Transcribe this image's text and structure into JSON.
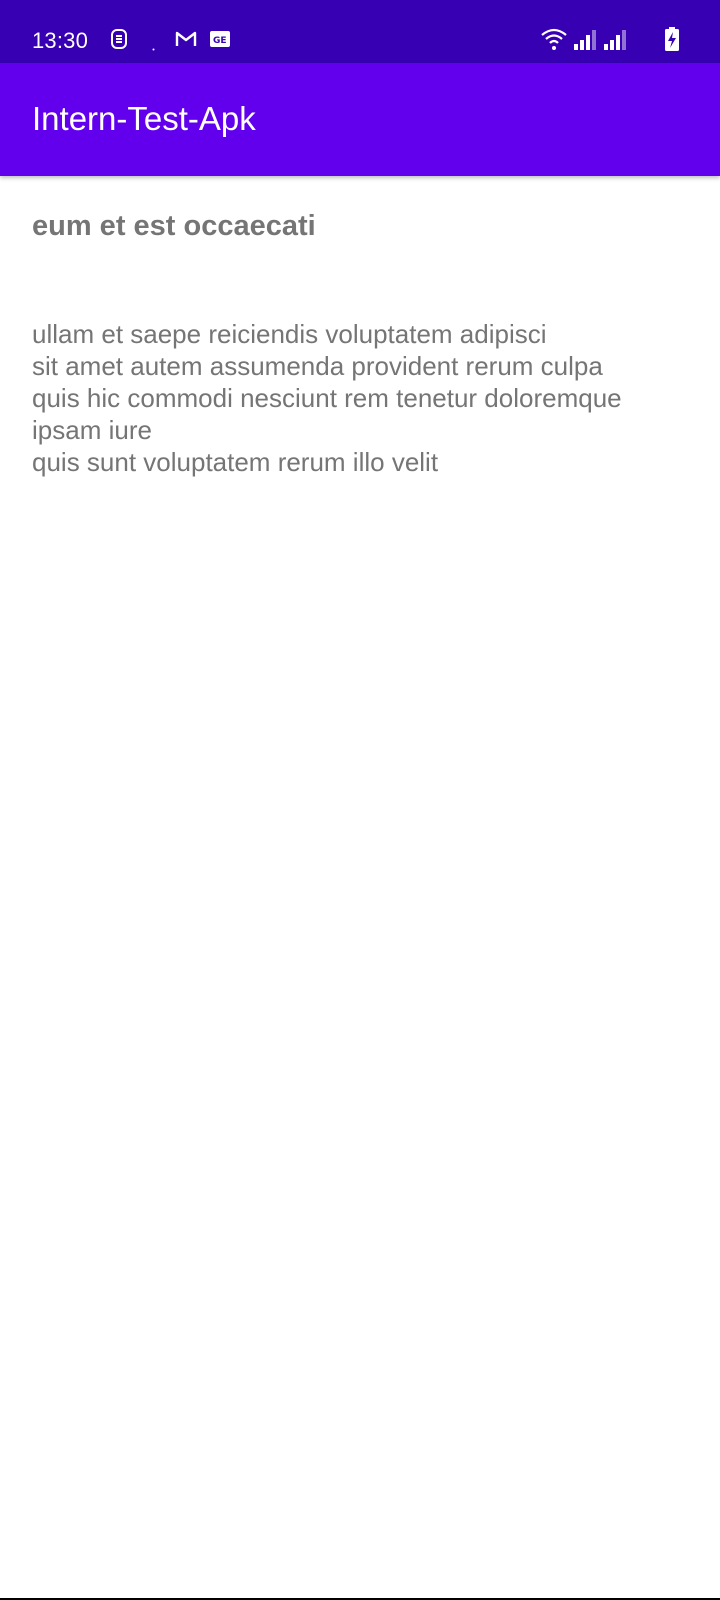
{
  "status_bar": {
    "time": "13:30",
    "background_color": "#3700b3",
    "left_icons": [
      "sim-notification-icon",
      "dot-icon",
      "gmail-icon",
      "news-icon"
    ],
    "right_icons": [
      "wifi-icon",
      "signal-icon",
      "signal-icon",
      "battery-charging-icon"
    ]
  },
  "app_bar": {
    "title": "Intern-Test-Apk",
    "background_color": "#6200ee"
  },
  "post": {
    "title": "eum et est occaecati",
    "body": "ullam et saepe reiciendis voluptatem adipisci\nsit amet autem assumenda provident rerum culpa\nquis hic commodi nesciunt rem tenetur doloremque ipsam iure\nquis sunt voluptatem rerum illo velit",
    "text_color": "#757575"
  }
}
